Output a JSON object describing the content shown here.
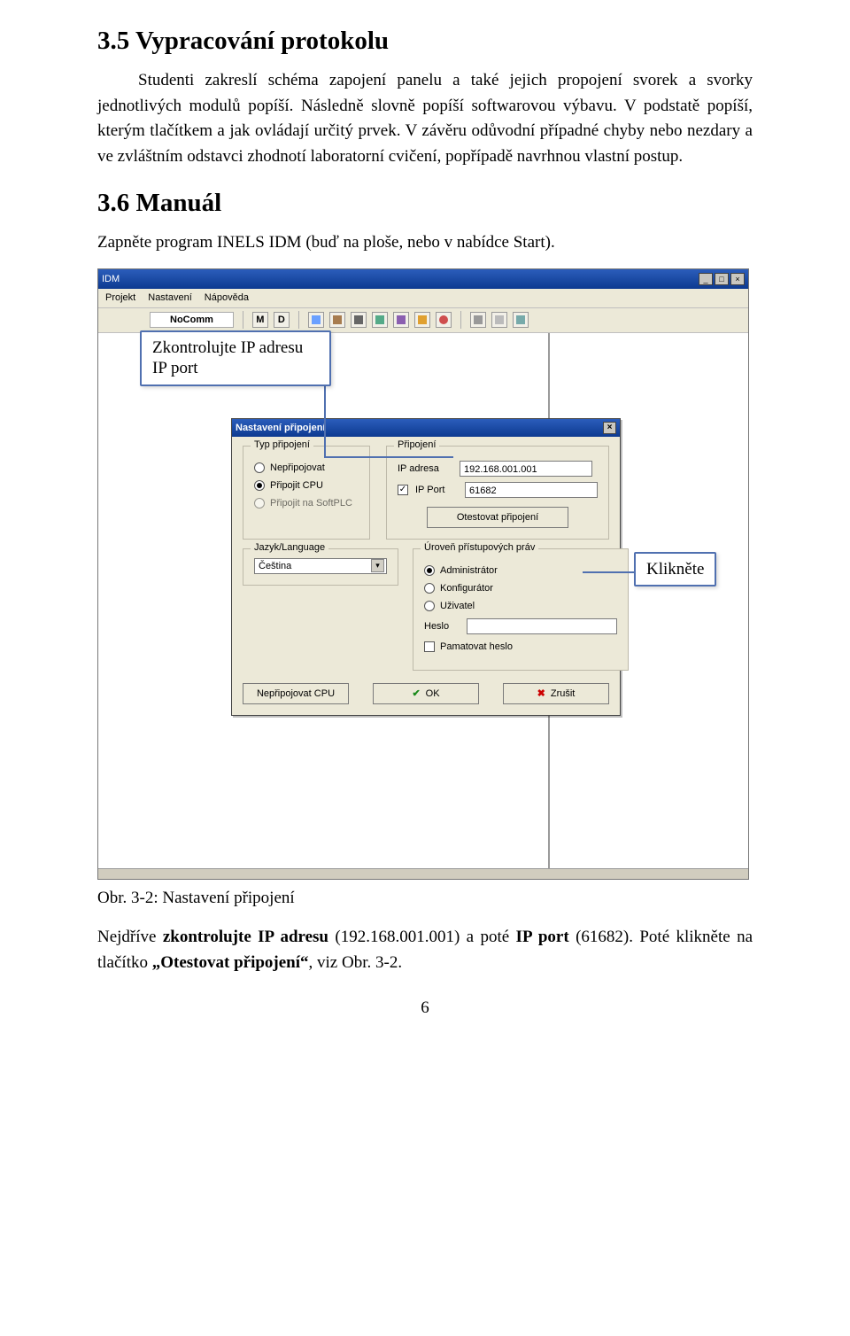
{
  "headings": {
    "h35": "3.5  Vypracování protokolu",
    "h36": "3.6  Manuál"
  },
  "paragraphs": {
    "p35": "Studenti zakreslí schéma zapojení panelu a také jejich propojení svorek a svorky jednotlivých modulů popíší. Následně slovně popíší softwarovou výbavu. V podstatě popíší, kterým tlačítkem a jak ovládají určitý prvek. V závěru odůvodní případné chyby nebo nezdary a ve zvláštním odstavci zhodnotí laboratorní cvičení, popřípadě navrhnou vlastní postup.",
    "p36": "Zapněte program INELS IDM (buď na ploše, nebo v nabídce Start)."
  },
  "callouts": {
    "ipcheck_l1": "Zkontrolujte IP adresu",
    "ipcheck_l2": "IP port",
    "click": "Klikněte"
  },
  "app": {
    "title": "IDM",
    "menu": {
      "m1": "Projekt",
      "m2": "Nastavení",
      "m3": "Nápověda"
    },
    "nocomm": "NoComm",
    "tb": {
      "m": "M",
      "d": "D"
    }
  },
  "dialog": {
    "title": "Nastavení připojení",
    "close": "×",
    "grp_typ": "Typ připojení",
    "r_nepri": "Nepřipojovat",
    "r_cpu": "Připojit CPU",
    "r_soft": "Připojit na SoftPLC",
    "grp_pripojeni": "Připojení",
    "lbl_ip": "IP adresa",
    "val_ip": "192.168.001.001",
    "chk_port": "IP Port",
    "val_port": "61682",
    "btn_test": "Otestovat připojení",
    "grp_prava": "Úroveň přístupových práv",
    "r_admin": "Administrátor",
    "r_konf": "Konfigurátor",
    "r_uziv": "Uživatel",
    "lbl_heslo": "Heslo",
    "chk_pamheslo": "Pamatovat heslo",
    "grp_lang": "Jazyk/Language",
    "sel_lang": "Čeština",
    "btn_nepcpu": "Nepřipojovat CPU",
    "btn_ok": "OK",
    "btn_cancel": "Zrušit"
  },
  "caption": "Obr. 3-2: Nastavení připojení",
  "after": {
    "t1": "Nejdříve ",
    "b1": "zkontrolujte IP adresu",
    "t2": " (192.168.001.001) a poté ",
    "b2": "IP port",
    "t3": " (61682). Poté klikněte na tlačítko ",
    "b3": "„Otestovat připojení“",
    "t4": ", viz Obr. 3-2."
  },
  "pagenum": "6"
}
